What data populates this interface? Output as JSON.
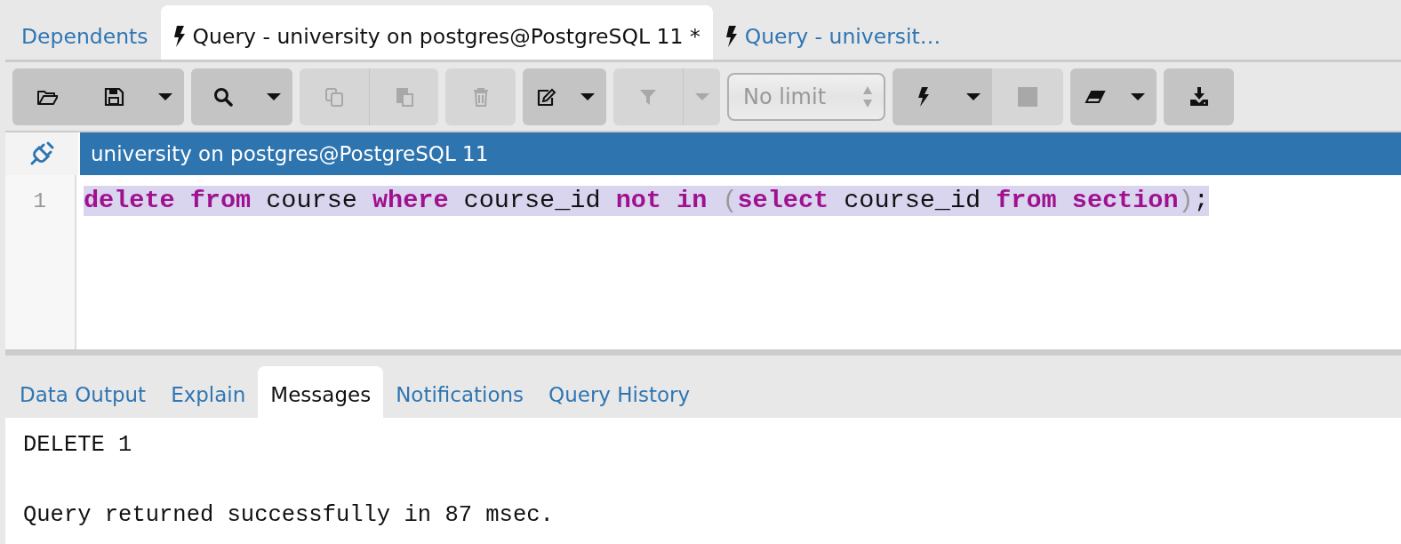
{
  "tabs": [
    {
      "label": "Dependents",
      "selected": false,
      "icon": false
    },
    {
      "label": "Query - university on postgres@PostgreSQL 11 *",
      "selected": true,
      "icon": true
    },
    {
      "label": "Query - universit…",
      "selected": false,
      "icon": true
    }
  ],
  "toolbar": [
    [
      {
        "kind": "open",
        "disabled": false
      },
      {
        "kind": "save",
        "disabled": false
      },
      {
        "kind": "caret",
        "disabled": false
      }
    ],
    [
      {
        "kind": "search",
        "disabled": false
      },
      {
        "kind": "caret",
        "disabled": false
      }
    ],
    [
      {
        "kind": "copy",
        "disabled": true
      },
      {
        "kind": "paste",
        "disabled": true
      }
    ],
    [
      {
        "kind": "delete",
        "disabled": true
      }
    ],
    [
      {
        "kind": "edit",
        "disabled": false
      },
      {
        "kind": "caret",
        "disabled": false
      }
    ],
    [
      {
        "kind": "filter",
        "disabled": true
      },
      {
        "kind": "caret",
        "disabled": true
      }
    ],
    [
      {
        "kind": "limit",
        "label": "No limit",
        "disabled": true
      }
    ],
    [
      {
        "kind": "execute",
        "disabled": false
      },
      {
        "kind": "caret",
        "disabled": false
      },
      {
        "kind": "stop",
        "disabled": true
      }
    ],
    [
      {
        "kind": "eraser",
        "disabled": false
      },
      {
        "kind": "caret",
        "disabled": false
      }
    ],
    [
      {
        "kind": "download",
        "disabled": false
      }
    ]
  ],
  "connection": {
    "label": "university on postgres@PostgreSQL 11"
  },
  "editor": {
    "lines": [
      {
        "number": "1",
        "highlighted": true,
        "tokens": [
          {
            "text": "delete ",
            "kind": "keyword"
          },
          {
            "text": "from",
            "kind": "keyword"
          },
          {
            "text": " course ",
            "kind": "plain"
          },
          {
            "text": "where",
            "kind": "keyword"
          },
          {
            "text": " course_id ",
            "kind": "plain"
          },
          {
            "text": "not ",
            "kind": "keyword"
          },
          {
            "text": "in",
            "kind": "keyword"
          },
          {
            "text": " (",
            "kind": "bracket"
          },
          {
            "text": "select",
            "kind": "keyword"
          },
          {
            "text": " course_id ",
            "kind": "plain"
          },
          {
            "text": "from ",
            "kind": "keyword"
          },
          {
            "text": "section",
            "kind": "keyword"
          },
          {
            "text": ")",
            "kind": "bracket"
          },
          {
            "text": ";",
            "kind": "plain"
          }
        ]
      }
    ]
  },
  "result_tabs": [
    {
      "label": "Data Output",
      "selected": false
    },
    {
      "label": "Explain",
      "selected": false
    },
    {
      "label": "Messages",
      "selected": true
    },
    {
      "label": "Notifications",
      "selected": false
    },
    {
      "label": "Query History",
      "selected": false
    }
  ],
  "messages": [
    "DELETE 1",
    "Query returned successfully in 87 msec."
  ]
}
